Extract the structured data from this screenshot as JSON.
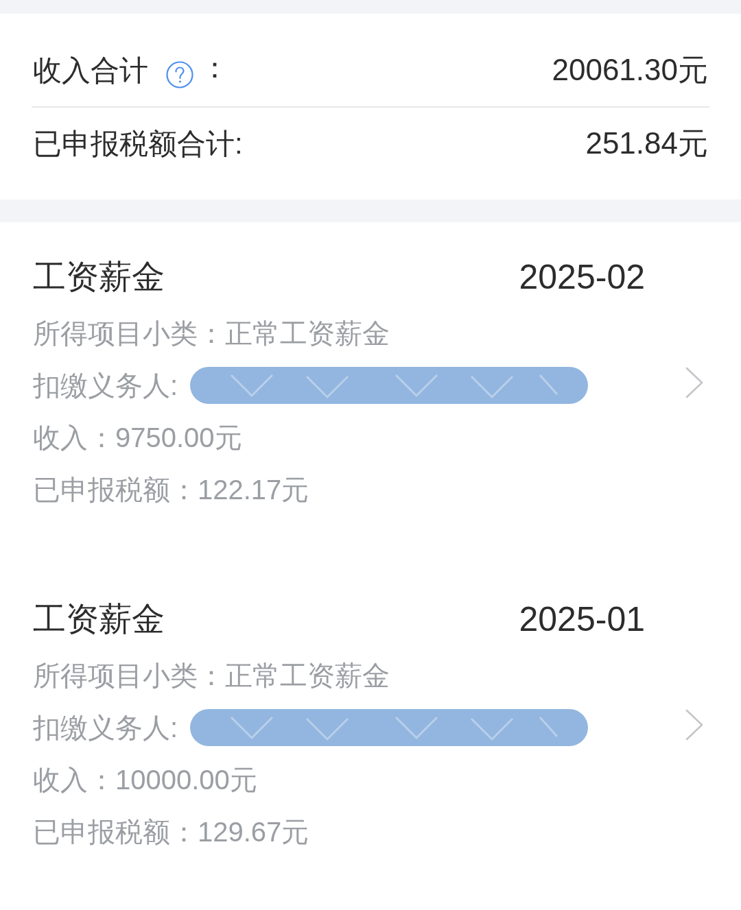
{
  "summary": {
    "rows": [
      {
        "label": "收入合计",
        "help": true,
        "colon": "：",
        "value": "20061.30元"
      },
      {
        "label": "已申报税额合计:",
        "help": false,
        "colon": "",
        "value": "251.84元"
      }
    ]
  },
  "records": [
    {
      "title": "工资薪金",
      "period": "2025-02",
      "lines": [
        {
          "kind": "text",
          "label": "所得项目小类：",
          "value": "正常工资薪金"
        },
        {
          "kind": "redacted",
          "label": "扣缴义务人:"
        },
        {
          "kind": "text",
          "label": "收入：",
          "value": "9750.00元"
        },
        {
          "kind": "text",
          "label": "已申报税额：",
          "value": "122.17元"
        }
      ]
    },
    {
      "title": "工资薪金",
      "period": "2025-01",
      "lines": [
        {
          "kind": "text",
          "label": "所得项目小类：",
          "value": "正常工资薪金"
        },
        {
          "kind": "redacted",
          "label": "扣缴义务人:"
        },
        {
          "kind": "text",
          "label": "收入：",
          "value": "10000.00元"
        },
        {
          "kind": "text",
          "label": "已申报税额：",
          "value": "129.67元"
        }
      ]
    }
  ]
}
